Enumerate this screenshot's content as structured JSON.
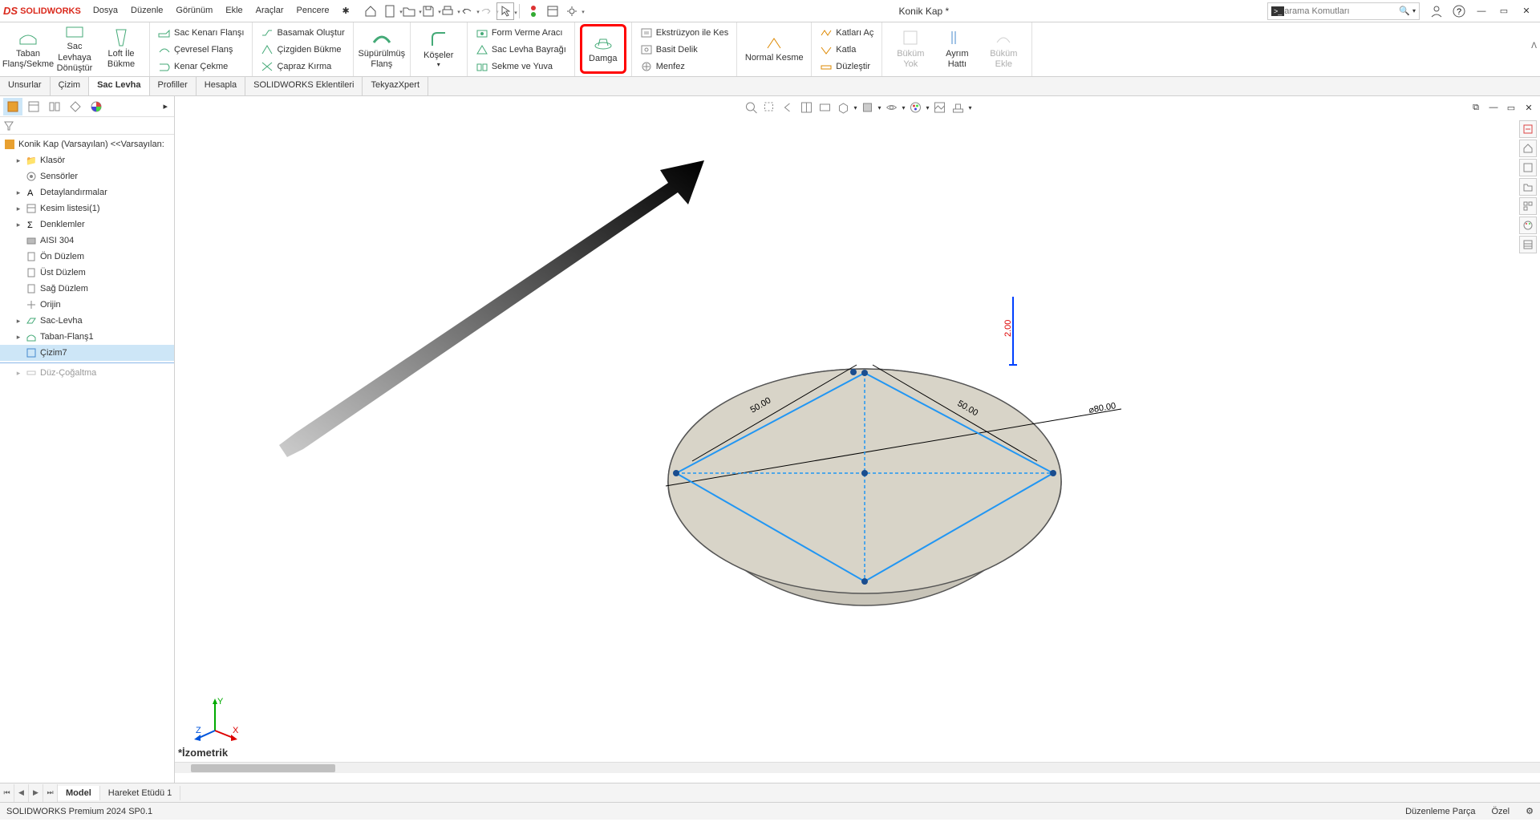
{
  "app": {
    "logo_text": "SOLIDWORKS",
    "doc_title": "Konik Kap *"
  },
  "menubar": [
    "Dosya",
    "Düzenle",
    "Görünüm",
    "Ekle",
    "Araçlar",
    "Pencere"
  ],
  "search": {
    "placeholder": "arama Komutları"
  },
  "ribbon": {
    "group1": [
      {
        "label": "Taban\nFlanş/Sekme"
      },
      {
        "label": "Sac Levhaya\nDönüştür"
      },
      {
        "label": "Loft İle\nBükme"
      }
    ],
    "group2": [
      "Sac Kenarı Flanşı",
      "Çevresel Flanş",
      "Kenar Çekme"
    ],
    "group3": [
      "Basamak Oluştur",
      "Çizgiden Bükme",
      "Çapraz Kırma"
    ],
    "group4": {
      "label": "Süpürülmüş\nFlanş"
    },
    "group5": {
      "label": "Köşeler"
    },
    "group6": [
      "Form Verme Aracı",
      "Sac Levha Bayrağı",
      "Sekme ve Yuva"
    ],
    "group7": {
      "label": "Damga"
    },
    "group8": [
      "Ekstrüzyon ile Kes",
      "Basit Delik",
      "Menfez"
    ],
    "group9": {
      "label": "Normal Kesme"
    },
    "group10": [
      "Katları Aç",
      "Katla",
      "Düzleştir"
    ],
    "group11": [
      {
        "label": "Büküm\nYok"
      },
      {
        "label": "Ayrım\nHattı"
      },
      {
        "label": "Büküm\nEkle"
      }
    ]
  },
  "tabs": [
    "Unsurlar",
    "Çizim",
    "Sac Levha",
    "Profiller",
    "Hesapla",
    "SOLIDWORKS Eklentileri",
    "TekyazXpert"
  ],
  "tabs_active": 2,
  "tree": {
    "root": "Konik Kap (Varsayılan) <<Varsayılan:",
    "items": [
      {
        "label": "Klasör",
        "exp": true
      },
      {
        "label": "Sensörler"
      },
      {
        "label": "Detaylandırmalar",
        "exp": true
      },
      {
        "label": "Kesim listesi(1)",
        "exp": true
      },
      {
        "label": "Denklemler",
        "exp": true
      },
      {
        "label": "AISI 304"
      },
      {
        "label": "Ön Düzlem"
      },
      {
        "label": "Üst Düzlem"
      },
      {
        "label": "Sağ Düzlem"
      },
      {
        "label": "Orijin"
      },
      {
        "label": "Sac-Levha",
        "exp": true
      },
      {
        "label": "Taban-Flanş1",
        "exp": true
      },
      {
        "label": "Çizim7",
        "selected": true
      },
      {
        "label": "Düz-Çoğaltma",
        "exp": true,
        "dim": true
      }
    ]
  },
  "dims": {
    "d1": "50.00",
    "d2": "50.00",
    "dia": "⌀80.00",
    "h": "2.00"
  },
  "view_label": "*İzometrik",
  "bottom_tabs": [
    "Model",
    "Hareket Etüdü 1"
  ],
  "statusbar": {
    "left": "SOLIDWORKS Premium 2024 SP0.1",
    "mode": "Düzenleme Parça",
    "unit": "Özel"
  }
}
